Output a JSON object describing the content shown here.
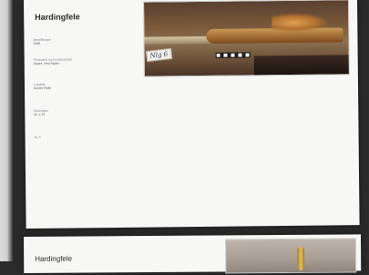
{
  "cards": [
    {
      "title": "Hardingfele",
      "fields": [
        {
          "label": "Identifikasjon",
          "value": "1998"
        },
        {
          "label": "Produsent og produksjonsår",
          "value": "Ukjent, Vest-Agder"
        },
        {
          "label": "Lokalitet",
          "value": "Nordre Rolle"
        },
        {
          "label": "Eksemplar",
          "value": "Nr. 1:15"
        },
        {
          "label": "Nr. 5",
          "value": ""
        }
      ],
      "photo_tag": "Nlg 6"
    },
    {
      "title": "Hardingfele"
    }
  ]
}
